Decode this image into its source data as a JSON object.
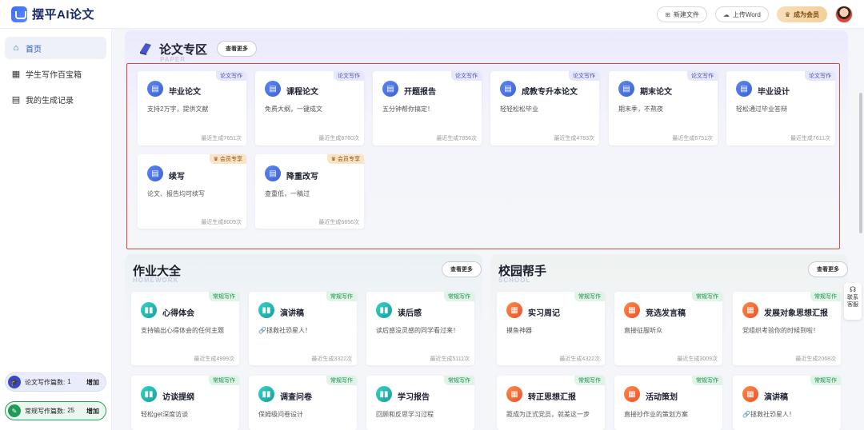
{
  "app": {
    "title": "摆平AI论文"
  },
  "header": {
    "new_file": "新建文件",
    "upload_word": "上传Word",
    "vip": "成为会员"
  },
  "sidebar": {
    "items": [
      {
        "label": "首页",
        "icon": "home-icon"
      },
      {
        "label": "学生写作百宝箱",
        "icon": "toolbox-icon"
      },
      {
        "label": "我的生成记录",
        "icon": "history-icon"
      }
    ],
    "quotas": [
      {
        "label": "论文写作篇数:",
        "value": "1",
        "action": "增加"
      },
      {
        "label": "常规写作篇数:",
        "value": "25",
        "action": "增加"
      }
    ]
  },
  "paper_section": {
    "title": "论文专区",
    "subtitle": "PAPER",
    "more": "查看更多",
    "cards": [
      {
        "tag": "论文写作",
        "title": "毕业论文",
        "desc": "支持2万字，提供文献",
        "count": "最近生成7651次"
      },
      {
        "tag": "论文写作",
        "title": "课程论文",
        "desc": "免费大纲，一键成文",
        "count": "最近生成8760次"
      },
      {
        "tag": "论文写作",
        "title": "开题报告",
        "desc": "五分钟帮你搞定！",
        "count": "最近生成7856次"
      },
      {
        "tag": "论文写作",
        "title": "成教专升本论文",
        "desc": "轻轻松松毕业",
        "count": "最近生成4783次"
      },
      {
        "tag": "论文写作",
        "title": "期末论文",
        "desc": "期末季，不熬夜",
        "count": "最近生成6751次"
      },
      {
        "tag": "论文写作",
        "title": "毕业设计",
        "desc": "轻松通过毕业答辩",
        "count": "最近生成7611次"
      },
      {
        "tag": "会员专享",
        "title": "续写",
        "desc": "论文、报告均可续写",
        "count": "最近生成8009次"
      },
      {
        "tag": "会员专享",
        "title": "降重改写",
        "desc": "查重低，一稿过",
        "count": "最近生成6656次"
      }
    ]
  },
  "homework_section": {
    "title": "作业大全",
    "subtitle": "HOMEWORK",
    "more": "查看更多",
    "cards": [
      {
        "tag": "常规写作",
        "title": "心得体会",
        "desc": "支持输出心得体会的任何主题",
        "count": "最近生成4999次"
      },
      {
        "tag": "常规写作",
        "title": "演讲稿",
        "desc": "🔗拯救社恐星人！",
        "count": "最近生成3322次"
      },
      {
        "tag": "常规写作",
        "title": "读后感",
        "desc": "读后感没灵感的同学看过来！",
        "count": "最近生成5111次"
      },
      {
        "tag": "常规写作",
        "title": "访谈提纲",
        "desc": "轻松get深度访谈",
        "count": ""
      },
      {
        "tag": "常规写作",
        "title": "调查问卷",
        "desc": "保姆级问卷设计",
        "count": ""
      },
      {
        "tag": "常规写作",
        "title": "学习报告",
        "desc": "回顾和反思学习过程",
        "count": ""
      }
    ]
  },
  "school_section": {
    "title": "校园帮手",
    "subtitle": "SCHOOL",
    "more": "查看更多",
    "cards": [
      {
        "tag": "常规写作",
        "title": "实习周记",
        "desc": "摸鱼神器",
        "count": "最近生成4322次"
      },
      {
        "tag": "常规写作",
        "title": "竞选发言稿",
        "desc": "直接征服听众",
        "count": "最近生成3009次"
      },
      {
        "tag": "常规写作",
        "title": "发展对象思想汇报",
        "desc": "党组织考验你的时候到啦！",
        "count": "最近生成2068次"
      },
      {
        "tag": "常规写作",
        "title": "转正思想汇报",
        "desc": "距成为正式党员，就差这一步",
        "count": ""
      },
      {
        "tag": "常规写作",
        "title": "活动策划",
        "desc": "直接抄作业的策划方案",
        "count": ""
      },
      {
        "tag": "常规写作",
        "title": "演讲稿",
        "desc": "🔗拯救社恐星人！",
        "count": ""
      }
    ]
  },
  "service": {
    "label": "联系客服"
  },
  "colors": {
    "accent": "#3b63d9",
    "highlight": "#e0463f",
    "vip": "#f3cf9b"
  }
}
